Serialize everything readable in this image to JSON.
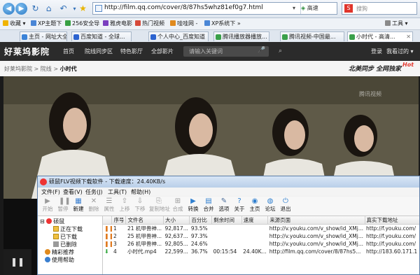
{
  "browser": {
    "address_url": "http://film.qq.com/cover/8/87hs5whz81ef0g7.html",
    "go_label": "高速",
    "search_placeholder": "搜狗",
    "favorites_label": "收藏",
    "tools_label": "工具",
    "bookmarks": [
      "XP主题下",
      "256安全导",
      "雅虎电影",
      "热门视频",
      "哇哇网 -",
      "XP系统下"
    ],
    "tabs": [
      {
        "label": "主页 - 网址大全",
        "active": false
      },
      {
        "label": "百度知道 - 全球...",
        "active": false
      },
      {
        "label": "个人中心_百度知道",
        "active": false
      },
      {
        "label": "腾讯播放器播放...",
        "active": false
      },
      {
        "label": "腾讯视频-中国最...",
        "active": false
      },
      {
        "label": "小时代 - 高清...",
        "active": true
      }
    ]
  },
  "site": {
    "logo": "好莱坞影院",
    "nav": [
      "首页",
      "院线同步区",
      "特色影厅",
      "全部影片"
    ],
    "search_placeholder": "请输入关键词",
    "login": "登录",
    "my_views": "我看过的 ▾",
    "breadcrumb": {
      "home": "好莱坞影院",
      "sep": " > ",
      "section": "院线",
      "current": "小时代"
    },
    "slogan": "北美同步 全网独家",
    "hot_badge": "Hot",
    "video_watermark": "腾讯视频"
  },
  "downloader": {
    "title": "硕鼠FLV视频下载软件 - 下载速度：24.40KB/s",
    "menus": [
      "文件(F)",
      "查看(V)",
      "任务(J)",
      "工具(T)",
      "帮助(H)"
    ],
    "toolbar": [
      {
        "label": "开始",
        "icon": "play-icon",
        "enabled": false
      },
      {
        "label": "暂停",
        "icon": "pause-icon",
        "enabled": false
      },
      {
        "label": "新建",
        "icon": "new-icon",
        "enabled": true
      },
      {
        "label": "删除",
        "icon": "delete-icon",
        "enabled": false
      },
      {
        "label": "属性",
        "icon": "properties-icon",
        "enabled": false
      },
      {
        "label": "上移",
        "icon": "up-icon",
        "enabled": false
      },
      {
        "label": "下移",
        "icon": "down-icon",
        "enabled": false
      },
      {
        "label": "复制地址",
        "icon": "copy-url-icon",
        "enabled": false
      },
      {
        "label": "合成",
        "icon": "merge-icon",
        "enabled": false
      },
      {
        "label": "转换",
        "icon": "convert-icon",
        "enabled": true
      },
      {
        "label": "合并",
        "icon": "combine-icon",
        "enabled": true
      },
      {
        "label": "选项",
        "icon": "options-icon",
        "enabled": true
      },
      {
        "label": "关于",
        "icon": "about-icon",
        "enabled": true
      },
      {
        "label": "主页",
        "icon": "home-icon",
        "enabled": true
      },
      {
        "label": "论坛",
        "icon": "forum-icon",
        "enabled": true
      },
      {
        "label": "退出",
        "icon": "exit-icon",
        "enabled": true
      }
    ],
    "tree": [
      "硕鼠",
      "正在下载",
      "已下载",
      "已删除",
      "精彩推荐",
      "使用帮助"
    ],
    "columns": [
      "序号",
      "文件名",
      "大小",
      "百分比",
      "剩余时间",
      "速度",
      "来源页面",
      "真实下载地址"
    ],
    "rows": [
      {
        "status": "paused",
        "idx": "1",
        "name": "21 机甲兽神...",
        "size": "92,817...",
        "pct": "93.5%",
        "remain": "",
        "speed": "",
        "source": "http://v.youku.com/v_show/id_XMj...",
        "real": "http://f.youku.com/"
      },
      {
        "status": "paused",
        "idx": "2",
        "name": "25 机甲兽神...",
        "size": "92,637...",
        "pct": "97.3%",
        "remain": "",
        "speed": "",
        "source": "http://v.youku.com/v_show/id_XMj...",
        "real": "http://f.youku.com/"
      },
      {
        "status": "paused",
        "idx": "3",
        "name": "26 机甲兽神...",
        "size": "92,805...",
        "pct": "24.6%",
        "remain": "",
        "speed": "",
        "source": "http://v.youku.com/v_show/id_XMj...",
        "real": "http://f.youku.com/"
      },
      {
        "status": "downloading",
        "idx": "4",
        "name": "小时代.mp4",
        "size": "22,599...",
        "pct": "36.7%",
        "remain": "00:15:54",
        "speed": "24.40K...",
        "source": "http://film.qq.com/cover/8/87hs5...",
        "real": "http://183.60.171.1"
      }
    ]
  },
  "colors": {
    "accent_red": "#e4392f",
    "header_dark": "#2b2b2b",
    "paused": "#e07a1f",
    "downloading": "#2fa53a"
  }
}
